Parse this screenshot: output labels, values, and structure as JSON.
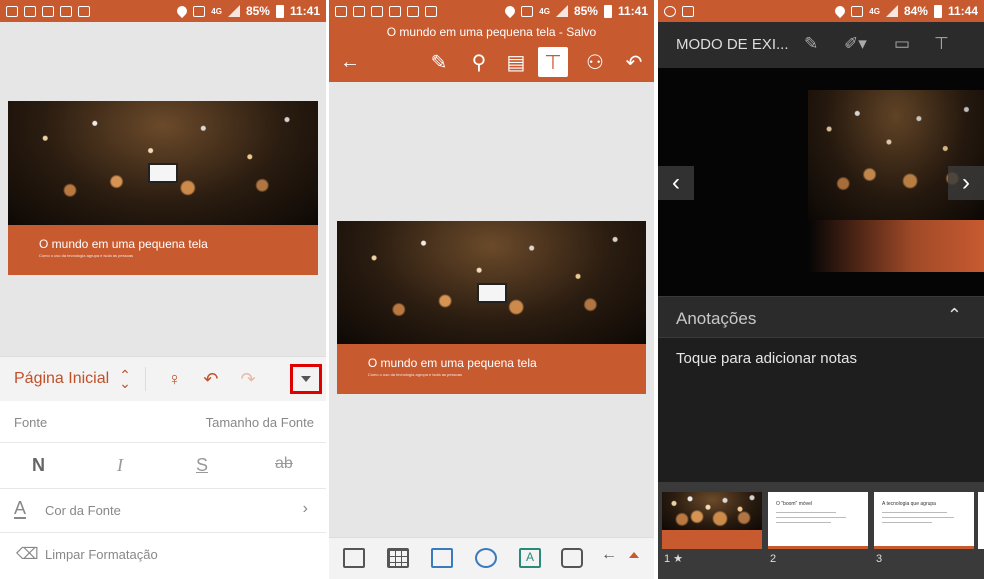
{
  "colors": {
    "accent": "#c85a30",
    "highlight": "#e10000",
    "dark": "#1e1e1e"
  },
  "panel1": {
    "status": {
      "battery": "85%",
      "time": "11:41",
      "network": "4G"
    },
    "slide": {
      "title": "O mundo em uma pequena tela",
      "subtitle": "Como o uso da tecnologia agrupa e isola as pessoas"
    },
    "ribbon": {
      "tab_label": "Página Inicial",
      "icons": [
        "lightbulb-icon",
        "undo-icon",
        "redo-icon",
        "expand-icon"
      ]
    },
    "font": {
      "font_label": "Fonte",
      "size_label": "Tamanho da Fonte",
      "bold": "N",
      "italic": "I",
      "underline": "S",
      "strike": "ab",
      "color_label": "Cor da Fonte",
      "clear_label": "Limpar Formatação"
    }
  },
  "panel2": {
    "status": {
      "battery": "85%",
      "time": "11:41",
      "network": "4G"
    },
    "title": "O mundo em uma pequena tela - Salvo",
    "toolbar": [
      "back-icon",
      "draw-icon",
      "search-icon",
      "notes-icon",
      "present-icon",
      "share-icon",
      "undo-icon"
    ],
    "slide": {
      "title": "O mundo em uma pequena tela",
      "subtitle": "Como o uso da tecnologia agrupa e isola as pessoas"
    },
    "bottom_icons": [
      "layout-icon",
      "table-icon",
      "picture-icon",
      "shapes-icon",
      "textbox-icon",
      "camera-icon",
      "arrow-left-icon",
      "collapse-icon"
    ]
  },
  "panel3": {
    "status": {
      "battery": "84%",
      "time": "11:44",
      "network": "4G"
    },
    "mode_label": "MODO DE EXI...",
    "notes_label": "Anotações",
    "notes_placeholder": "Toque para adicionar notas",
    "thumbs": [
      {
        "num": "1 ★",
        "title": ""
      },
      {
        "num": "2",
        "title": "O \"boom\" móvel"
      },
      {
        "num": "3",
        "title": "A tecnologia que agrupa"
      }
    ]
  }
}
